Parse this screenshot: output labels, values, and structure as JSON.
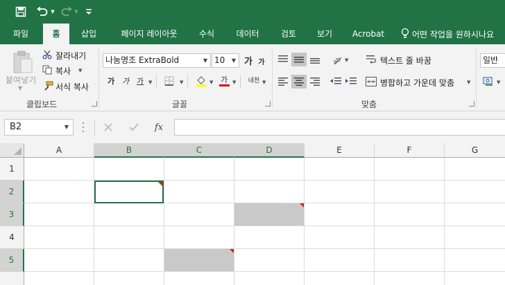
{
  "colors": {
    "brand": "#217346",
    "comment_indicator": "#d0201a",
    "cell_fill": "#c9c9c9"
  },
  "qat": {
    "save_icon": "save-icon",
    "undo_icon": "undo-icon",
    "redo_icon": "redo-icon",
    "customize_icon": "customize-qat-icon"
  },
  "tabs": [
    {
      "label": "파일",
      "active": false
    },
    {
      "label": "홈",
      "active": true
    },
    {
      "label": "삽입",
      "active": false
    },
    {
      "label": "페이지 레이아웃",
      "active": false
    },
    {
      "label": "수식",
      "active": false
    },
    {
      "label": "데이터",
      "active": false
    },
    {
      "label": "검토",
      "active": false
    },
    {
      "label": "보기",
      "active": false
    },
    {
      "label": "Acrobat",
      "active": false
    }
  ],
  "tell_me": "어떤 작업을 원하시나요",
  "clipboard": {
    "group_label": "클립보드",
    "paste": "붙여넣기",
    "cut": "잘라내기",
    "copy": "복사",
    "format_painter": "서식 복사"
  },
  "font": {
    "group_label": "글꼴",
    "font_name": "나눔명조 ExtraBold",
    "font_size": "10",
    "grow": "가",
    "shrink": "가",
    "bold": "가",
    "italic": "가",
    "underline": "가",
    "font_color": "가",
    "phonetic": "내천"
  },
  "alignment": {
    "group_label": "맞춤",
    "wrap_text": "텍스트 줄 바꿈",
    "merge_center": "병합하고 가운데 맞춤"
  },
  "number": {
    "format": "일반"
  },
  "formula_bar": {
    "name_box": "B2",
    "fx": "fx",
    "formula": ""
  },
  "sheet": {
    "columns": [
      "A",
      "B",
      "C",
      "D",
      "E",
      "F",
      "G"
    ],
    "rows": [
      "1",
      "2",
      "3",
      "4",
      "5"
    ],
    "selected_cell": "B2"
  }
}
